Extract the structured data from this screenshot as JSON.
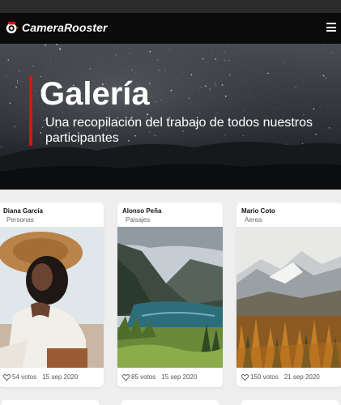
{
  "navbar": {
    "brand": "CameraRooster",
    "brand_icon": "rooster-camera-icon",
    "menu_icon": "hamburger-menu-icon"
  },
  "hero": {
    "title": "Galería",
    "subtitle": "Una recopilación del trabajo de todos nuestros participantes",
    "accent_color": "#e01010"
  },
  "cards": [
    {
      "name": "Diana García",
      "category": "Personas",
      "votes": "54 votos",
      "date": "15 sep 2020"
    },
    {
      "name": "Alonso Peña",
      "category": "Paisajes",
      "votes": "85 votos",
      "date": "15 sep 2020"
    },
    {
      "name": "Mario Coto",
      "category": "Aerea",
      "votes": "150 votos",
      "date": "21 sep 2020"
    }
  ]
}
